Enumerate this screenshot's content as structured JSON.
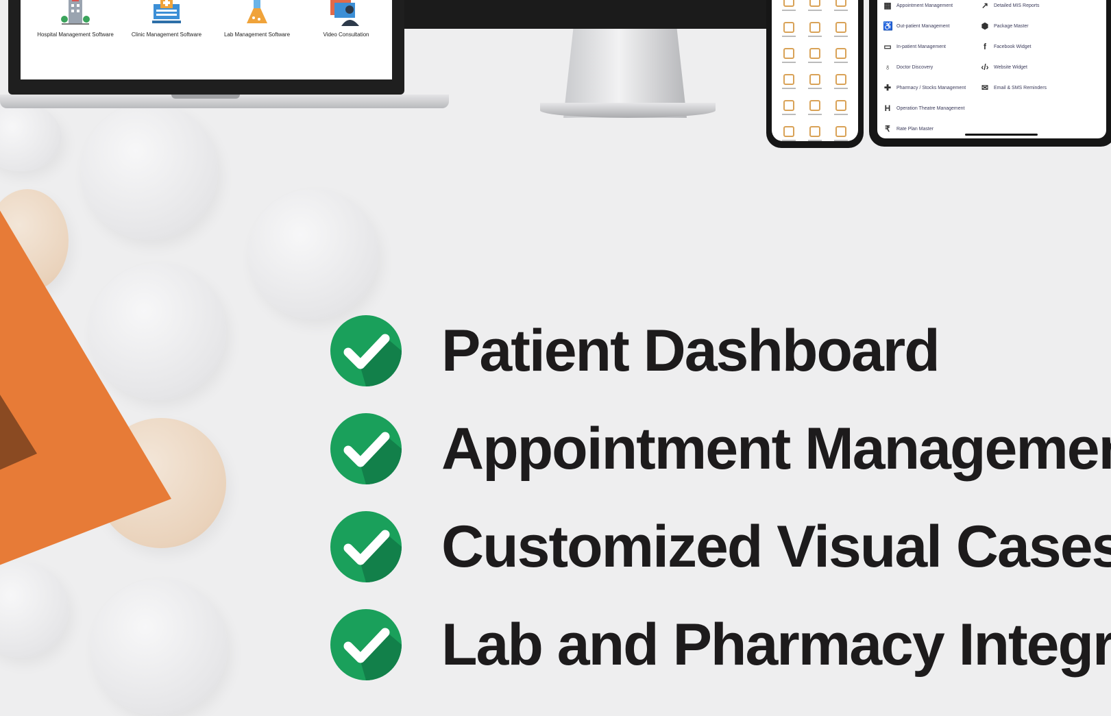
{
  "laptop": {
    "items": [
      {
        "label": "Hospital Management Software",
        "icon": "hospital-icon"
      },
      {
        "label": "Clinic Management Software",
        "icon": "clinic-icon"
      },
      {
        "label": "Lab Management Software",
        "icon": "lab-flask-icon"
      },
      {
        "label": "Video Consultation",
        "icon": "video-consultation-icon"
      }
    ]
  },
  "tablet": {
    "left_items": [
      {
        "label": "Appointment Management",
        "icon": "calendar-icon"
      },
      {
        "label": "Out-patient Management",
        "icon": "wheelchair-icon"
      },
      {
        "label": "In-patient Management",
        "icon": "bed-icon"
      },
      {
        "label": "Doctor Discovery",
        "icon": "stethoscope-icon"
      },
      {
        "label": "Pharmacy / Stocks Management",
        "icon": "medical-kit-icon"
      },
      {
        "label": "Operation Theatre Management",
        "icon": "hospital-h-icon"
      },
      {
        "label": "Rate Plan Master",
        "icon": "rupee-icon"
      }
    ],
    "right_items": [
      {
        "label": "Detailed MIS Reports",
        "icon": "chart-line-icon"
      },
      {
        "label": "Package Master",
        "icon": "packages-icon"
      },
      {
        "label": "Facebook Widget",
        "icon": "facebook-icon"
      },
      {
        "label": "Website Widget",
        "icon": "code-icon"
      },
      {
        "label": "Email & SMS Reminders",
        "icon": "envelope-icon"
      }
    ]
  },
  "features": [
    {
      "label": "Patient Dashboard"
    },
    {
      "label": "Appointment Managemen"
    },
    {
      "label": "Customized Visual Casesh"
    },
    {
      "label": "Lab and Pharmacy Integra"
    }
  ],
  "colors": {
    "accent_orange": "#e77b37",
    "check_green": "#1aa05b",
    "text_dark": "#1d1b1c",
    "background": "#eeeeef"
  }
}
